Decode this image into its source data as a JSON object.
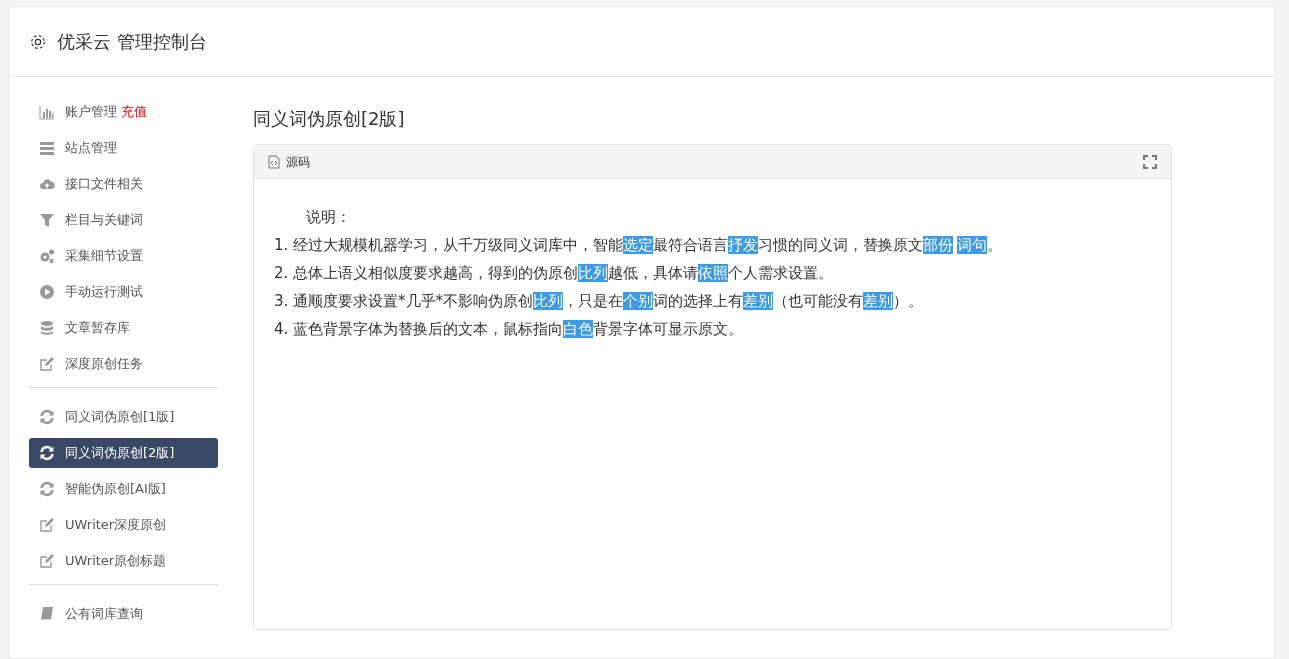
{
  "header": {
    "title": "优采云 管理控制台"
  },
  "sidebar": {
    "groups": [
      {
        "items": [
          {
            "label": "账户管理",
            "badge": "充值",
            "selected": false
          },
          {
            "label": "站点管理",
            "selected": false
          },
          {
            "label": "接口文件相关",
            "selected": false
          },
          {
            "label": "栏目与关键词",
            "selected": false
          },
          {
            "label": "采集细节设置",
            "selected": false
          },
          {
            "label": "手动运行测试",
            "selected": false
          },
          {
            "label": "文章暂存库",
            "selected": false
          },
          {
            "label": "深度原创任务",
            "selected": false
          }
        ]
      },
      {
        "items": [
          {
            "label": "同义词伪原创[1版]",
            "selected": false
          },
          {
            "label": "同义词伪原创[2版]",
            "selected": true
          },
          {
            "label": "智能伪原创[AI版]",
            "selected": false
          },
          {
            "label": "UWriter深度原创",
            "selected": false
          },
          {
            "label": "UWriter原创标题",
            "selected": false
          }
        ]
      },
      {
        "items": [
          {
            "label": "公有词库查询",
            "selected": false
          }
        ]
      }
    ]
  },
  "main": {
    "title": "同义词伪原创[2版]",
    "panel": {
      "tab": "源码",
      "heading": "说明：",
      "lines": [
        {
          "segments": [
            {
              "text": "1. 经过大规模机器学习，从千万级同义词库中，智能",
              "highlighted": false
            },
            {
              "text": "选定",
              "highlighted": true
            },
            {
              "text": "最符合语言",
              "highlighted": false
            },
            {
              "text": "抒发",
              "highlighted": true
            },
            {
              "text": "习惯的同义词，替换原文",
              "highlighted": false
            },
            {
              "text": "部份",
              "highlighted": true
            },
            {
              "text": "词句",
              "highlighted": true
            },
            {
              "text": "。",
              "highlighted": false
            }
          ]
        },
        {
          "segments": [
            {
              "text": "2. 总体上语义相似度要求越高，得到的伪原创",
              "highlighted": false
            },
            {
              "text": "比列",
              "highlighted": true
            },
            {
              "text": "越低，具体请",
              "highlighted": false
            },
            {
              "text": "依照",
              "highlighted": true
            },
            {
              "text": "个人需求设置。",
              "highlighted": false
            }
          ]
        },
        {
          "segments": [
            {
              "text": "3. 通顺度要求设置*几乎*不影响伪原创",
              "highlighted": false
            },
            {
              "text": "比列",
              "highlighted": true
            },
            {
              "text": "，只是在",
              "highlighted": false
            },
            {
              "text": "个别",
              "highlighted": true
            },
            {
              "text": "词的选择上有",
              "highlighted": false
            },
            {
              "text": "差别",
              "highlighted": true
            },
            {
              "text": "（也可能没有",
              "highlighted": false
            },
            {
              "text": "差别",
              "highlighted": true
            },
            {
              "text": "）。",
              "highlighted": false
            }
          ]
        },
        {
          "segments": [
            {
              "text": "4. 蓝色背景字体为替换后的文本，鼠标指向",
              "highlighted": false
            },
            {
              "text": "白色",
              "highlighted": true
            },
            {
              "text": "背景字体可显示原文。",
              "highlighted": false
            }
          ]
        }
      ]
    }
  }
}
